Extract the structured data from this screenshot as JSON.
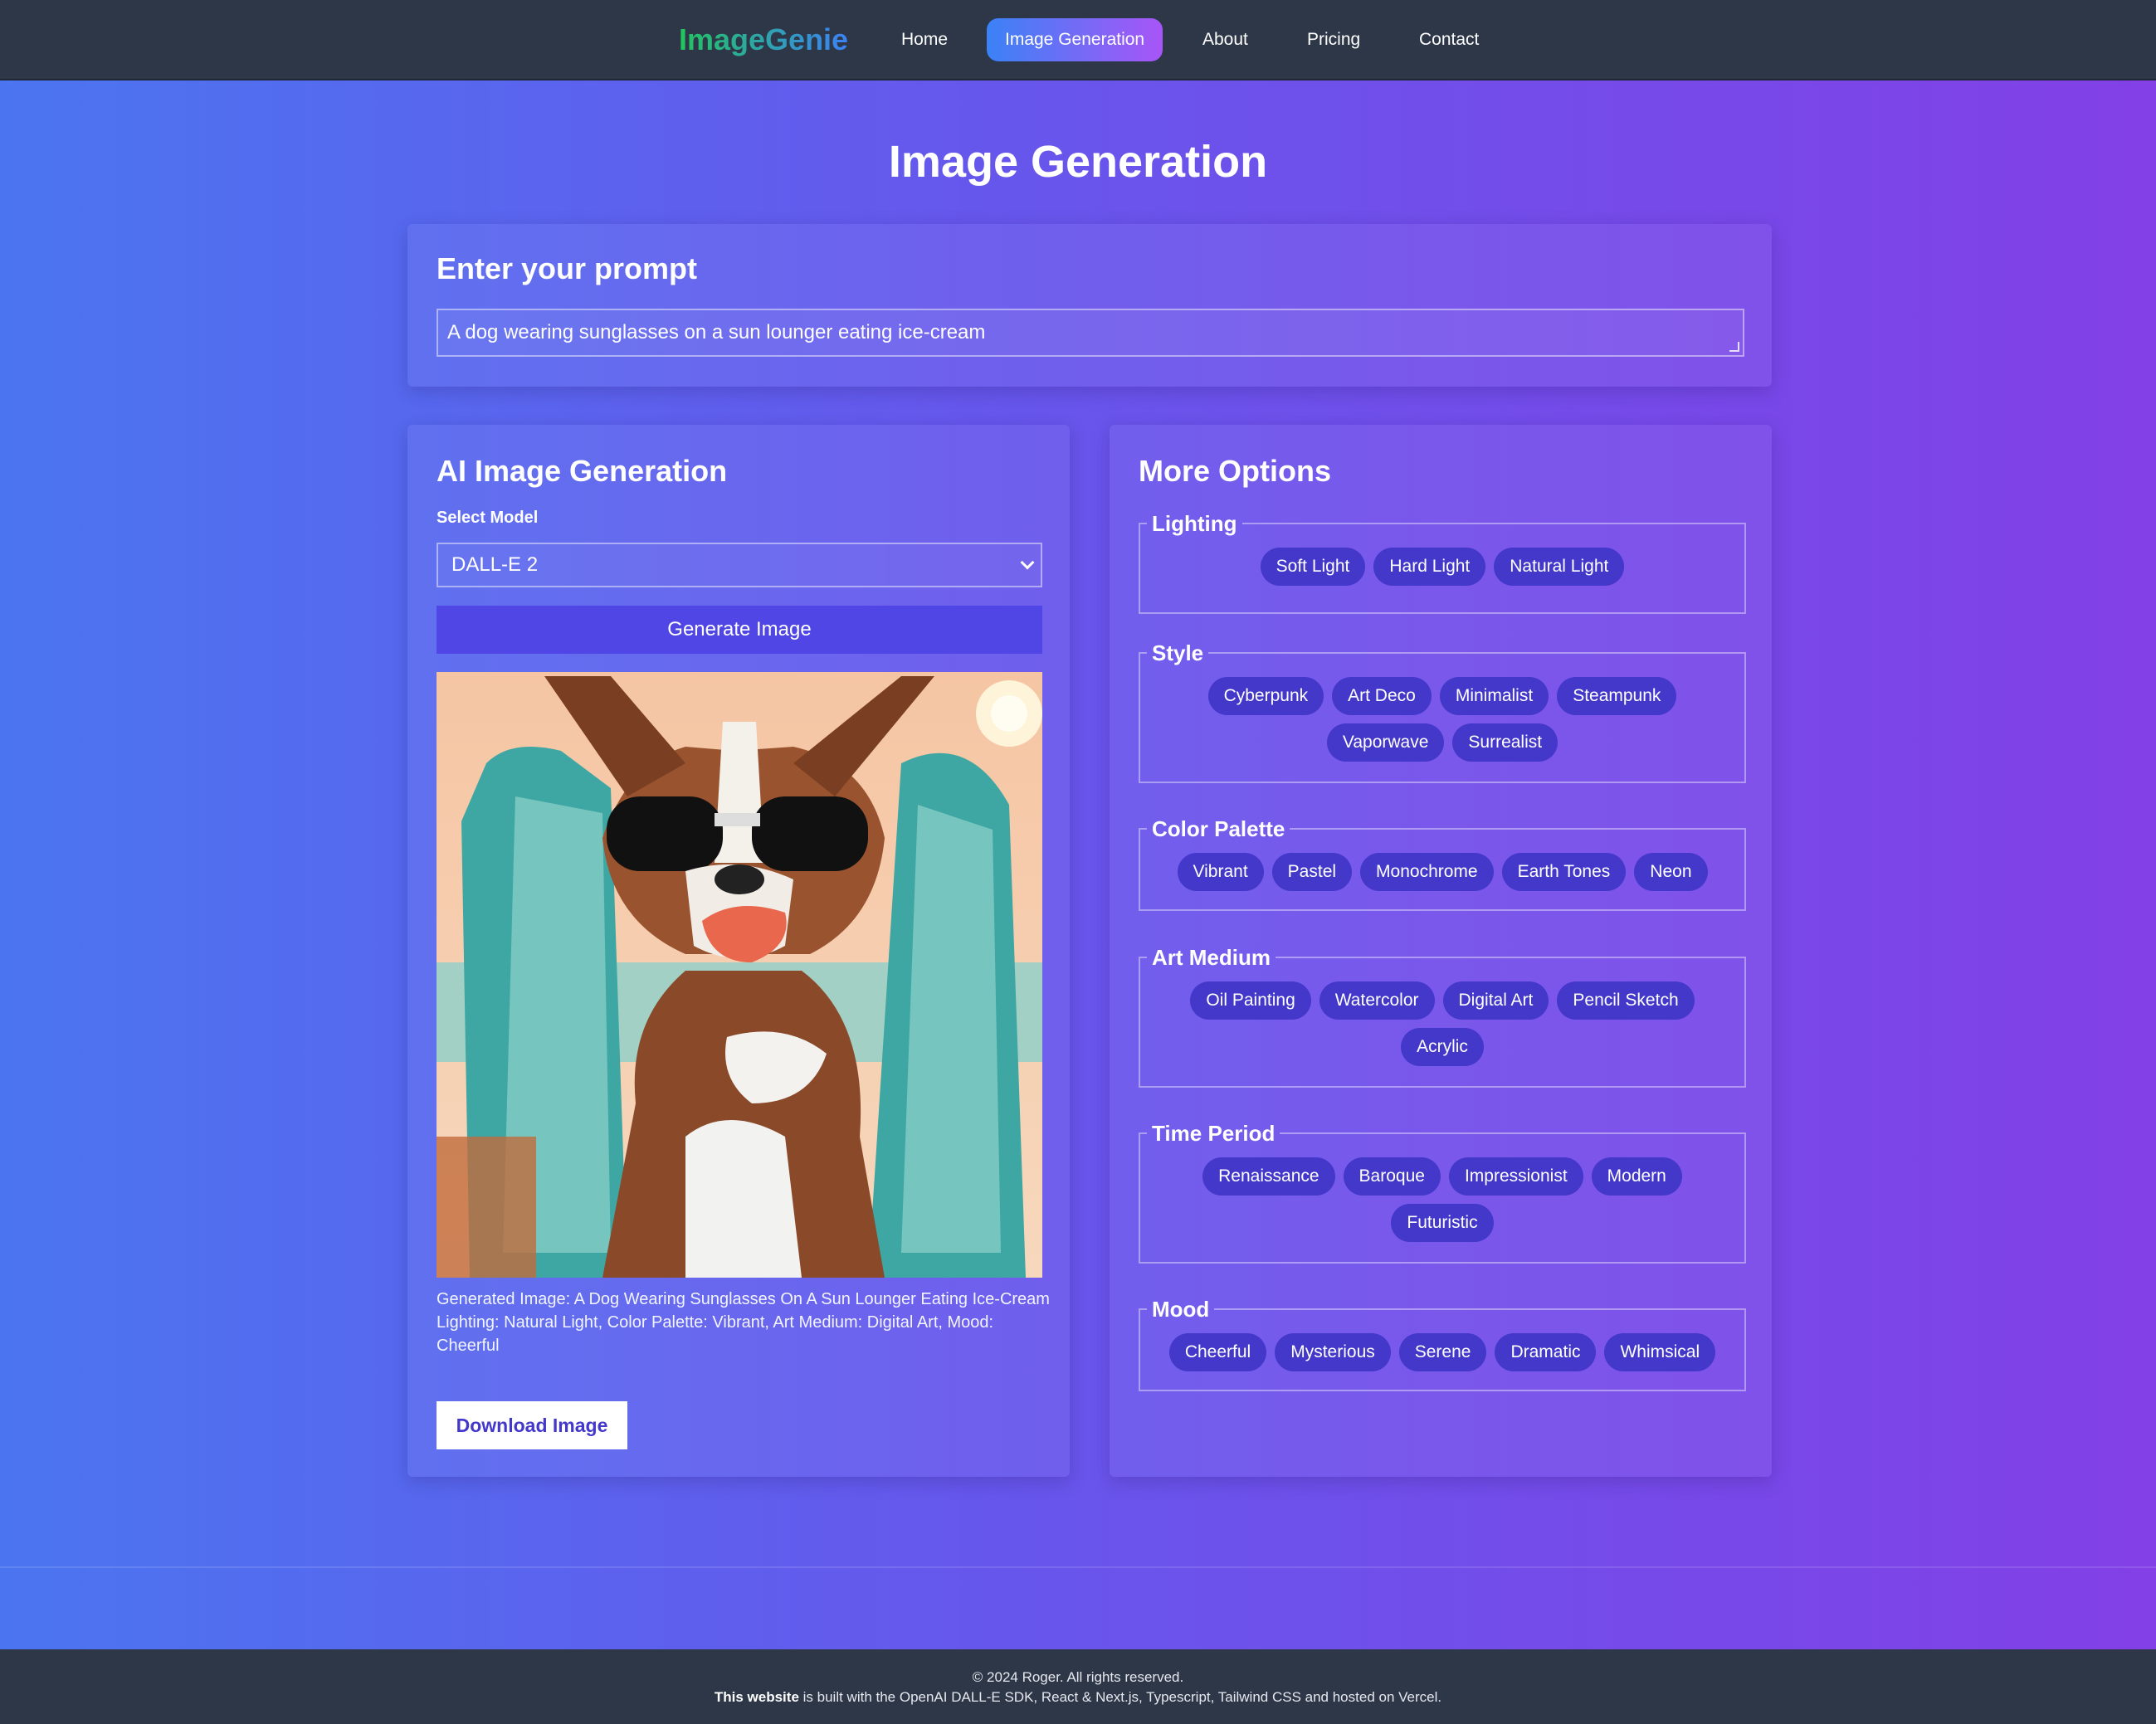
{
  "nav": {
    "logo": "ImageGenie",
    "items": [
      {
        "label": "Home",
        "active": false
      },
      {
        "label": "Image Generation",
        "active": true
      },
      {
        "label": "About",
        "active": false
      },
      {
        "label": "Pricing",
        "active": false
      },
      {
        "label": "Contact",
        "active": false
      }
    ]
  },
  "page": {
    "title": "Image Generation"
  },
  "prompt": {
    "heading": "Enter your prompt",
    "value": "A dog wearing sunglasses on a sun lounger eating ice-cream"
  },
  "generation": {
    "heading": "AI Image Generation",
    "model_label": "Select Model",
    "model_value": "DALL-E 2",
    "generate_label": "Generate Image",
    "caption_line1": "Generated Image: A Dog Wearing Sunglasses On A Sun Lounger Eating Ice-Cream",
    "caption_line2": "Lighting: Natural Light, Color Palette: Vibrant, Art Medium: Digital Art, Mood: Cheerful",
    "download_label": "Download Image"
  },
  "options": {
    "heading": "More Options",
    "groups": [
      {
        "title": "Lighting",
        "chips": [
          "Soft Light",
          "Hard Light",
          "Natural Light"
        ]
      },
      {
        "title": "Style",
        "chips": [
          "Cyberpunk",
          "Art Deco",
          "Minimalist",
          "Steampunk",
          "Vaporwave",
          "Surrealist"
        ]
      },
      {
        "title": "Color Palette",
        "chips": [
          "Vibrant",
          "Pastel",
          "Monochrome",
          "Earth Tones",
          "Neon"
        ]
      },
      {
        "title": "Art Medium",
        "chips": [
          "Oil Painting",
          "Watercolor",
          "Digital Art",
          "Pencil Sketch",
          "Acrylic"
        ]
      },
      {
        "title": "Time Period",
        "chips": [
          "Renaissance",
          "Baroque",
          "Impressionist",
          "Modern",
          "Futuristic"
        ]
      },
      {
        "title": "Mood",
        "chips": [
          "Cheerful",
          "Mysterious",
          "Serene",
          "Dramatic",
          "Whimsical"
        ]
      }
    ]
  },
  "footer": {
    "copyright": "© 2024 Roger. All rights reserved.",
    "built_bold": "This website",
    "built_rest": " is built with the OpenAI DALL-E SDK, React & Next.js, Typescript, Tailwind CSS and hosted on Vercel."
  },
  "colors": {
    "nav_bg": "#2d3748",
    "accent": "#4f46e5",
    "chip": "#4338ca"
  }
}
